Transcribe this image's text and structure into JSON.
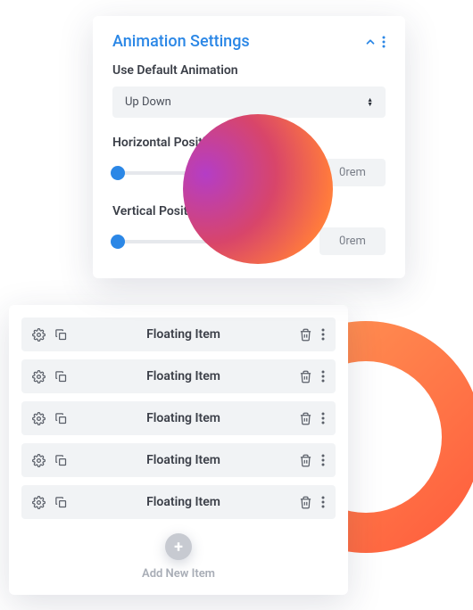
{
  "settings": {
    "title": "Animation Settings",
    "default_animation_label": "Use Default Animation",
    "default_animation_value": "Up Down",
    "horizontal_label": "Horizontal Position",
    "horizontal_value": "0rem",
    "vertical_label": "Vertical Position",
    "vertical_value": "0rem"
  },
  "list": {
    "items": [
      {
        "label": "Floating Item"
      },
      {
        "label": "Floating Item"
      },
      {
        "label": "Floating Item"
      },
      {
        "label": "Floating Item"
      },
      {
        "label": "Floating Item"
      }
    ],
    "add_label": "Add New Item"
  }
}
